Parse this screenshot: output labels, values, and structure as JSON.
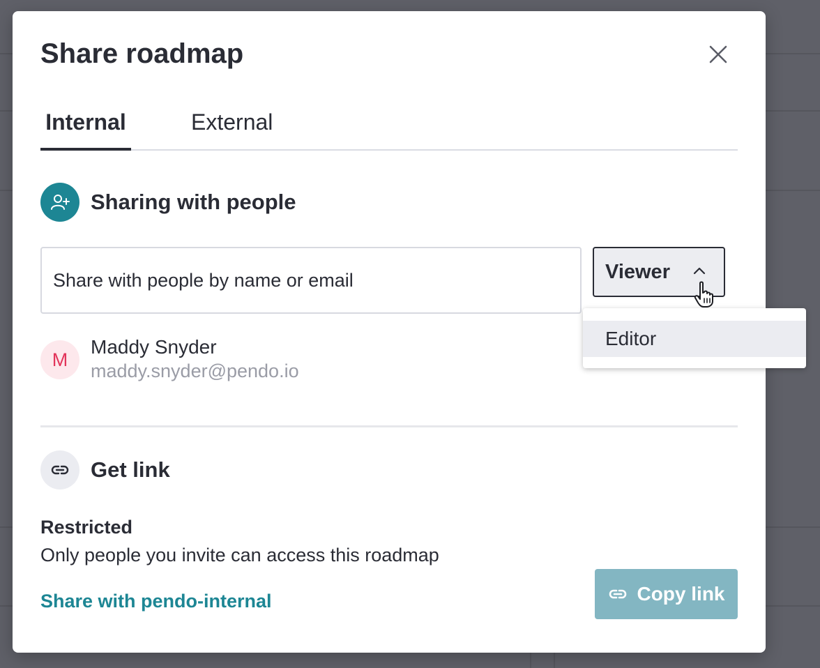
{
  "modal": {
    "title": "Share roadmap",
    "close_icon": "close-icon"
  },
  "tabs": [
    {
      "label": "Internal",
      "active": true
    },
    {
      "label": "External",
      "active": false
    }
  ],
  "sharing_section": {
    "icon": "person-add-icon",
    "title": "Sharing with people",
    "input_placeholder": "Share with people by name or email",
    "role_selected": "Viewer",
    "role_options": [
      "Editor"
    ]
  },
  "people": [
    {
      "initial": "M",
      "name": "Maddy Snyder",
      "email": "maddy.snyder@pendo.io"
    }
  ],
  "link_section": {
    "icon": "link-icon",
    "title": "Get link",
    "access_level": "Restricted",
    "access_description": "Only people you invite can access this roadmap",
    "share_domain_link": "Share with pendo-internal",
    "copy_button_label": "Copy link"
  },
  "colors": {
    "accent": "#1d8694",
    "button_disabled": "#83b6c2",
    "avatar_bg": "#fde8ec",
    "avatar_text": "#e2345a"
  }
}
